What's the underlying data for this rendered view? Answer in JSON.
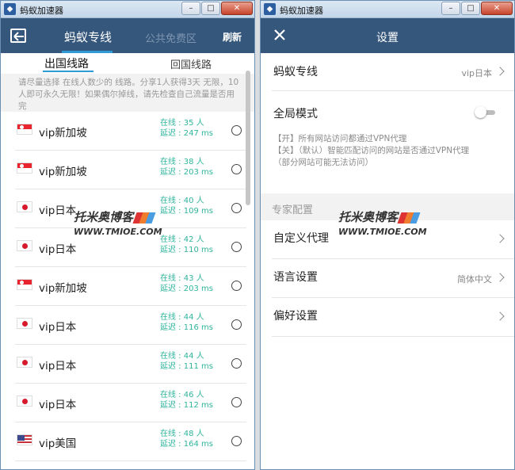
{
  "app": {
    "title": "蚂蚁加速器"
  },
  "left": {
    "tab_active": "蚂蚁专线",
    "tab_inactive": "公共免费区",
    "refresh": "刷新",
    "subtab_active": "出国线路",
    "subtab_inactive": "回国线路",
    "notice": "请尽量选择 在线人数少的 线路。分享1人获得3天 无限，10人即可永久无限！如果偶尔掉线，请先检查自己流量是否用完",
    "servers": [
      {
        "flag": "sg",
        "name": "vip新加坡",
        "online": "在线 : 35 人",
        "latency": "延迟 : 247 ms"
      },
      {
        "flag": "sg",
        "name": "vip新加坡",
        "online": "在线 : 38 人",
        "latency": "延迟 : 203 ms"
      },
      {
        "flag": "jp",
        "name": "vip日本",
        "online": "在线 : 40 人",
        "latency": "延迟 : 109 ms"
      },
      {
        "flag": "jp",
        "name": "vip日本",
        "online": "在线 : 42 人",
        "latency": "延迟 : 110 ms"
      },
      {
        "flag": "sg",
        "name": "vip新加坡",
        "online": "在线 : 43 人",
        "latency": "延迟 : 203 ms"
      },
      {
        "flag": "jp",
        "name": "vip日本",
        "online": "在线 : 44 人",
        "latency": "延迟 : 116 ms"
      },
      {
        "flag": "jp",
        "name": "vip日本",
        "online": "在线 : 44 人",
        "latency": "延迟 : 111 ms"
      },
      {
        "flag": "jp",
        "name": "vip日本",
        "online": "在线 : 46 人",
        "latency": "延迟 : 112 ms"
      },
      {
        "flag": "us",
        "name": "vip美国",
        "online": "在线 : 48 人",
        "latency": "延迟 : 164 ms"
      }
    ]
  },
  "right": {
    "title": "设置",
    "line_label": "蚂蚁专线",
    "line_value": "vip日本",
    "global_label": "全局模式",
    "global_on": false,
    "desc_on": "【开】所有网站访问都通过VPN代理",
    "desc_off": "【关】（默认）智能匹配访问的网站是否通过VPN代理",
    "desc_note": "（部分网站可能无法访问）",
    "section": "专家配置",
    "custom_proxy": "自定义代理",
    "language_label": "语言设置",
    "language_value": "简体中文",
    "preference": "偏好设置"
  },
  "watermark": {
    "cn": "托米奥博客",
    "en": "WWW.TMIOE.COM"
  }
}
